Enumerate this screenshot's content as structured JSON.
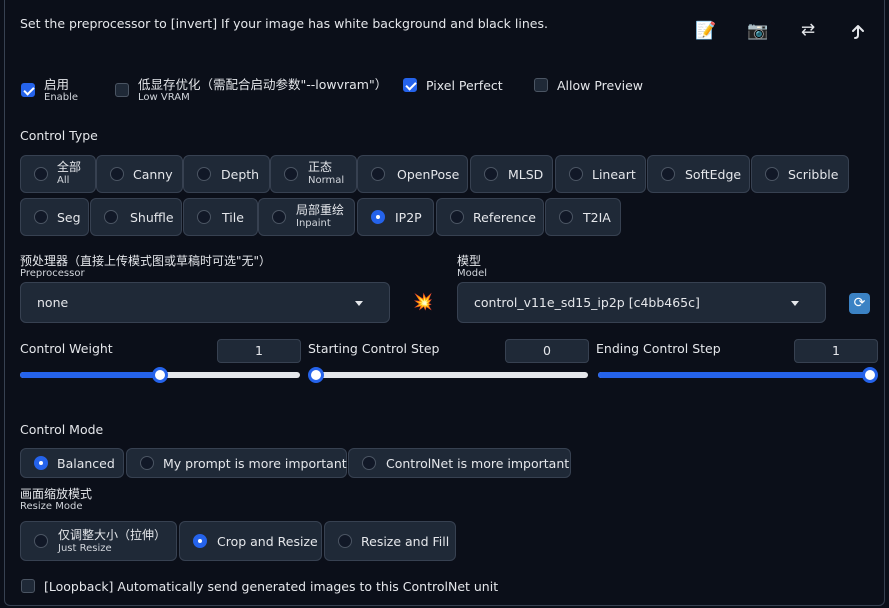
{
  "hint": "Set the preprocessor to [invert] If your image has white background and black lines.",
  "toolbar": [
    {
      "name": "edit-icon",
      "glyph": "📝"
    },
    {
      "name": "camera-icon",
      "glyph": "📷"
    },
    {
      "name": "swap-icon",
      "glyph": "⇄"
    },
    {
      "name": "send-up-icon",
      "glyph": ""
    }
  ],
  "checks": {
    "enable": {
      "label": "启用",
      "sub": "Enable",
      "checked": true
    },
    "low_vram": {
      "label": "低显存优化（需配合启动参数\"--lowvram\"）",
      "sub": "Low VRAM",
      "checked": false
    },
    "pixel_perfect": {
      "label": "Pixel Perfect",
      "checked": true
    },
    "allow_preview": {
      "label": "Allow Preview",
      "checked": false
    }
  },
  "control_type": {
    "label": "Control Type",
    "options": [
      {
        "label": "全部",
        "sub": "All"
      },
      {
        "label": "Canny"
      },
      {
        "label": "Depth"
      },
      {
        "label": "正态",
        "sub": "Normal"
      },
      {
        "label": "OpenPose"
      },
      {
        "label": "MLSD"
      },
      {
        "label": "Lineart"
      },
      {
        "label": "SoftEdge"
      },
      {
        "label": "Scribble"
      },
      {
        "label": "Seg"
      },
      {
        "label": "Shuffle"
      },
      {
        "label": "Tile"
      },
      {
        "label": "局部重绘",
        "sub": "Inpaint"
      },
      {
        "label": "IP2P"
      },
      {
        "label": "Reference"
      },
      {
        "label": "T2IA"
      }
    ],
    "selected": "IP2P"
  },
  "preprocessor": {
    "label": "预处理器（直接上传模式图或草稿时可选\"无\"）",
    "sub": "Preprocessor",
    "value": "none"
  },
  "model": {
    "label": "模型",
    "sub": "Model",
    "value": "control_v11e_sd15_ip2p [c4bb465c]"
  },
  "sliders": {
    "weight": {
      "label": "Control Weight",
      "value": "1",
      "fraction": 0.5
    },
    "start": {
      "label": "Starting Control Step",
      "value": "0",
      "fraction": 0
    },
    "end": {
      "label": "Ending Control Step",
      "value": "1",
      "fraction": 1
    }
  },
  "control_mode": {
    "label": "Control Mode",
    "options": [
      "Balanced",
      "My prompt is more important",
      "ControlNet is more important"
    ],
    "selected": "Balanced"
  },
  "resize_mode": {
    "label": "画面缩放模式",
    "sub": "Resize Mode",
    "options": [
      {
        "label": "仅调整大小（拉伸）",
        "sub": "Just Resize"
      },
      {
        "label": "Crop and Resize"
      },
      {
        "label": "Resize and Fill"
      }
    ],
    "selected": "Crop and Resize"
  },
  "loopback": {
    "label": "[Loopback] Automatically send generated images to this ControlNet unit",
    "checked": false
  },
  "colors": {
    "accent": "#2563eb",
    "background": "#0b0f19",
    "surface": "#1f2937",
    "border": "#374151"
  }
}
